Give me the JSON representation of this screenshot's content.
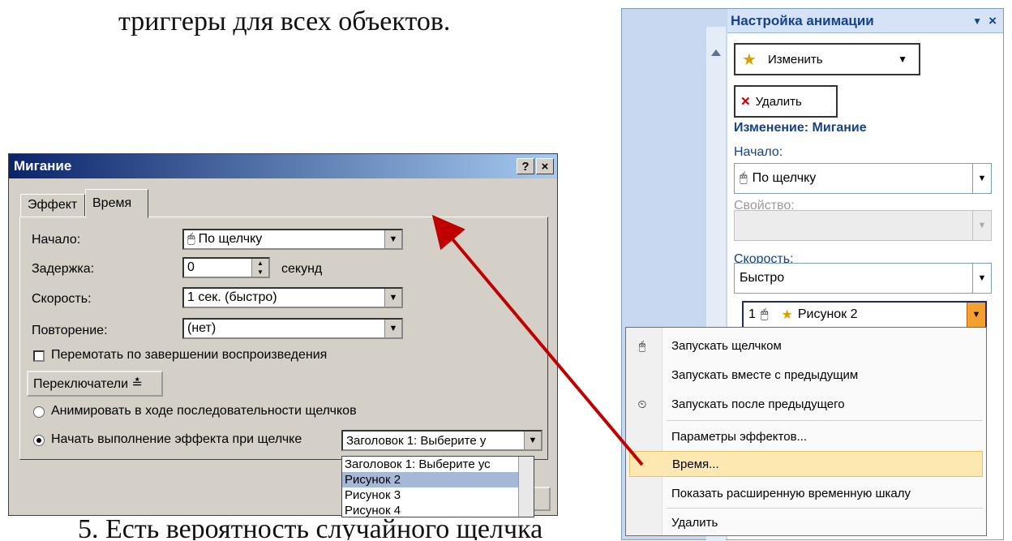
{
  "document": {
    "top_text": "триггеры для всех объектов.",
    "bottom_text": "5. Есть вероятность случайного щелчка"
  },
  "dialog": {
    "title": "Мигание",
    "help_btn": "?",
    "close_btn": "×",
    "tabs": [
      {
        "label": "Эффект"
      },
      {
        "label": "Время"
      }
    ],
    "fields": {
      "start_label": "Начало:",
      "start_value": "По щелчку",
      "delay_label": "Задержка:",
      "delay_value": "0",
      "delay_unit": "секунд",
      "speed_label": "Скорость:",
      "speed_value": "1 сек. (быстро)",
      "repeat_label": "Повторение:",
      "repeat_value": "(нет)"
    },
    "rewind_label": "Перемотать по завершении воспроизведения",
    "triggers_button": "Переключатели ≛",
    "radio_animate": "Анимировать в ходе последовательности щелчков",
    "radio_start_on_click": "Начать выполнение эффекта при щелчке",
    "trigger_combo_value": "Заголовок 1: Выберите у",
    "trigger_list": [
      "Заголовок 1: Выберите ус",
      "Рисунок 2",
      "Рисунок 3",
      "Рисунок 4"
    ]
  },
  "task_pane": {
    "title": "Настройка анимации",
    "change_button": "Изменить",
    "delete_button": "Удалить",
    "section_title": "Изменение: Мигание",
    "start_label": "Начало:",
    "start_value": "По щелчку",
    "property_label": "Свойство:",
    "speed_label": "Скорость:",
    "speed_value": "Быстро",
    "list_item": {
      "number": "1",
      "name": "Рисунок 2"
    }
  },
  "context_menu": {
    "items": [
      "Запускать щелчком",
      "Запускать вместе с предыдущим",
      "Запускать после предыдущего",
      "Параметры эффектов...",
      "Время...",
      "Показать расширенную временную шкалу",
      "Удалить"
    ],
    "highlighted_index": 4
  },
  "colors": {
    "arrow": "#c00000",
    "menu_highlight": "#fde8b2",
    "titlebar": "#0a246a"
  }
}
